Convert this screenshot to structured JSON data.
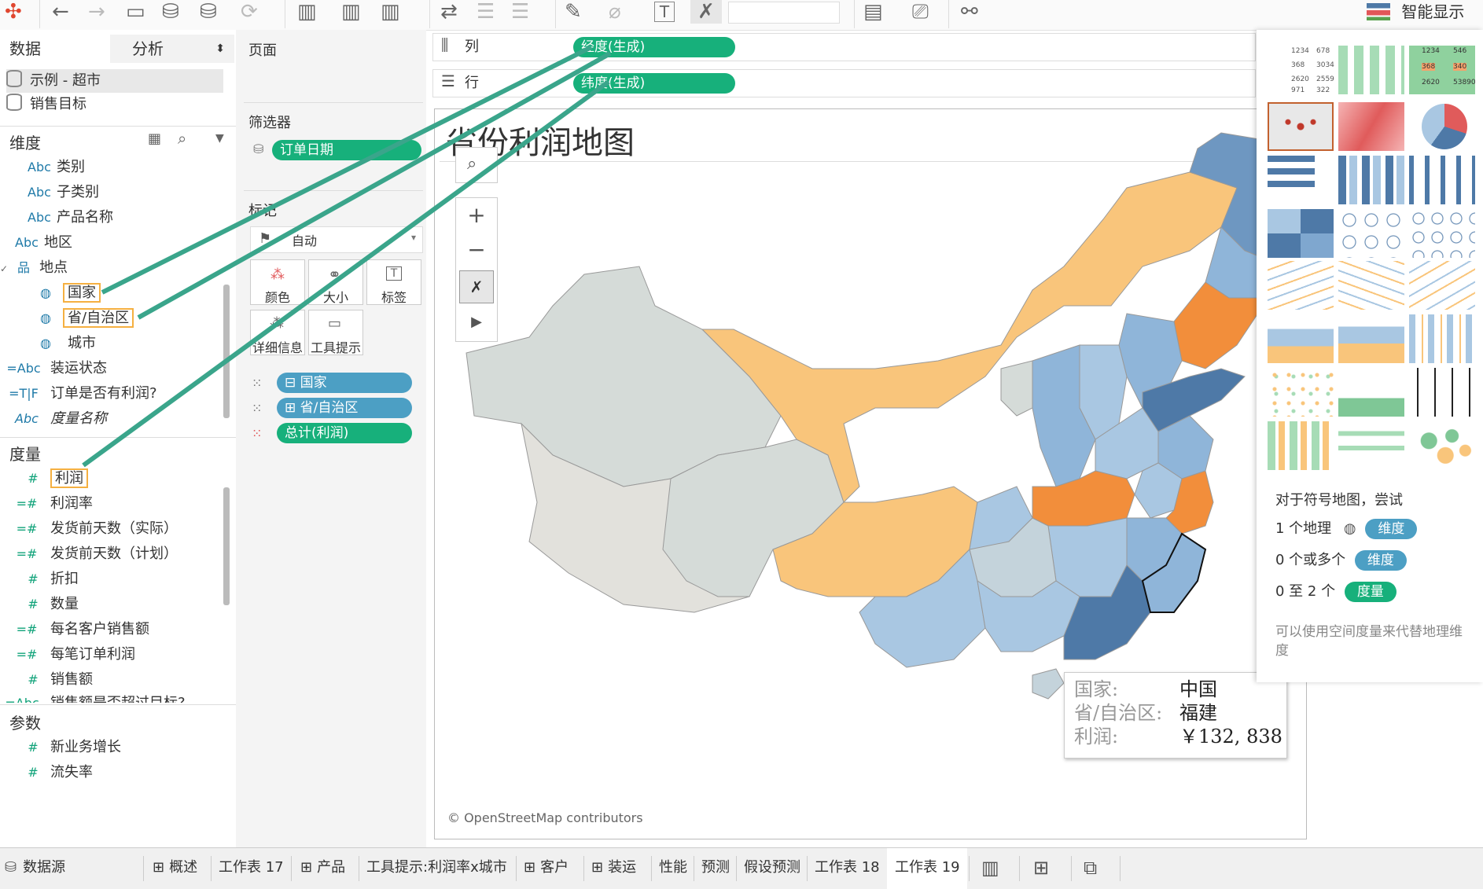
{
  "toolbar": {
    "smart_display": "智能显示"
  },
  "data_pane": {
    "tab_data": "数据",
    "tab_analysis": "分析",
    "sources": [
      "示例 - 超市",
      "销售目标"
    ],
    "dimensions_header": "维度",
    "dimensions": [
      {
        "type": "Abc",
        "name": "类别"
      },
      {
        "type": "Abc",
        "name": "子类别"
      },
      {
        "type": "Abc",
        "name": "产品名称"
      },
      {
        "type": "Abc",
        "name": "地区"
      },
      {
        "type": "hier",
        "name": "地点"
      },
      {
        "type": "geo",
        "name": "国家"
      },
      {
        "type": "geo",
        "name": "省/自治区"
      },
      {
        "type": "geo",
        "name": "城市"
      },
      {
        "type": "=Abc",
        "name": "装运状态"
      },
      {
        "type": "=T|F",
        "name": "订单是否有利润?"
      },
      {
        "type": "Abc",
        "name": "度量名称"
      }
    ],
    "measures_header": "度量",
    "measures": [
      {
        "type": "#",
        "name": "利润"
      },
      {
        "type": "=#",
        "name": "利润率"
      },
      {
        "type": "=#",
        "name": "发货前天数（实际）"
      },
      {
        "type": "=#",
        "name": "发货前天数（计划）"
      },
      {
        "type": "#",
        "name": "折扣"
      },
      {
        "type": "#",
        "name": "数量"
      },
      {
        "type": "=#",
        "name": "每名客户销售额"
      },
      {
        "type": "=#",
        "name": "每笔订单利润"
      },
      {
        "type": "#",
        "name": "销售额"
      },
      {
        "type": "=Abc",
        "name": "销售额是否超过目标?"
      }
    ],
    "params_header": "参数",
    "params": [
      {
        "type": "#",
        "name": "新业务增长"
      },
      {
        "type": "#",
        "name": "流失率"
      }
    ]
  },
  "cards": {
    "pages": "页面",
    "filters": "筛选器",
    "filter_pill": "订单日期",
    "marks": "标记",
    "mark_type": "自动",
    "btn_color": "颜色",
    "btn_size": "大小",
    "btn_label": "标签",
    "btn_detail": "详细信息",
    "btn_tooltip": "工具提示",
    "mark_pills": [
      "国家",
      "省/自治区",
      "总计(利润)"
    ]
  },
  "shelves": {
    "columns_label": "列",
    "columns_pill": "经度(生成)",
    "rows_label": "行",
    "rows_pill": "纬度(生成)"
  },
  "view": {
    "title": "省份利润地图",
    "attribution": "© OpenStreetMap contributors",
    "tooltip": {
      "country_label": "国家:",
      "country_value": "中国",
      "province_label": "省/自治区:",
      "province_value": "福建",
      "profit_label": "利润:",
      "profit_value": "￥132, 838"
    }
  },
  "show_me": {
    "hint1": "对于符号地图，尝试",
    "line1_prefix": "1 个地理",
    "line1_pill": "维度",
    "line2_prefix": "0 个或多个",
    "line2_pill": "维度",
    "line3_prefix": "0 至 2 个",
    "line3_pill": "度量",
    "note": "可以使用空间度量来代替地理维度",
    "thumb_text_table": [
      "1234",
      "678",
      "368",
      "3034",
      "2620",
      "2559",
      "971",
      "322"
    ],
    "thumb_heat_table": [
      "1234",
      "546",
      "368",
      "340",
      "2620",
      "53890"
    ]
  },
  "bottom_tabs": [
    "数据源",
    "概述",
    "工作表 17",
    "产品",
    "工具提示:利润率x城市",
    "客户",
    "装运",
    "性能",
    "预测",
    "假设预测",
    "工作表 18",
    "工作表 19"
  ],
  "colors": {
    "accent_green": "#17b07b",
    "accent_blue": "#4c9fc4",
    "positive_dark": "#4e79a7",
    "positive_light": "#a9c7e2",
    "negative_light": "#f9c57b",
    "negative_dark": "#f28e3b"
  }
}
